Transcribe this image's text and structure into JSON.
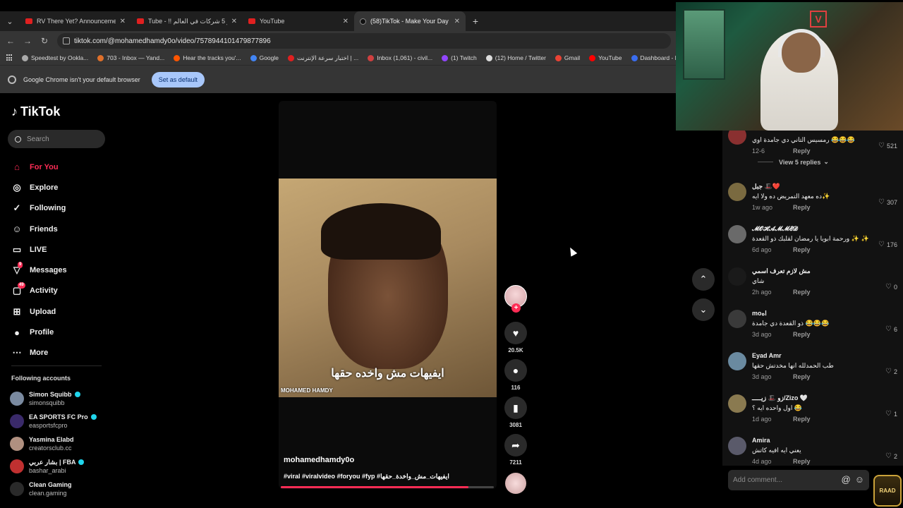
{
  "browser": {
    "tabs": [
      {
        "label": "RV There Yet? Announcement T",
        "favicon": "youtube",
        "active": false
      },
      {
        "label": "Tube - !! أكبر 5 شركات في العالم",
        "favicon": "youtube",
        "active": false
      },
      {
        "label": "YouTube",
        "favicon": "youtube",
        "active": false
      },
      {
        "label": "(58)TikTok - Make Your Day",
        "favicon": "tiktok",
        "active": true
      }
    ],
    "url": "tiktok.com/@mohamedhamdy0o/video/7578944101479877896",
    "bookmarks": [
      {
        "label": "Speedtest by Ookla...",
        "color": "#aaaaaa"
      },
      {
        "label": "703 - Inbox — Yand...",
        "color": "#e0702a"
      },
      {
        "label": "Hear the tracks you'...",
        "color": "#ff5500"
      },
      {
        "label": "Google",
        "color": "#4285f4"
      },
      {
        "label": "اختبار سرعة الإنترنت | ...",
        "color": "#e02020"
      },
      {
        "label": "Inbox (1,061) - civil...",
        "color": "#d04040"
      },
      {
        "label": "(1) Twitch",
        "color": "#9146ff"
      },
      {
        "label": "(12) Home / Twitter",
        "color": "#dddddd"
      },
      {
        "label": "Gmail",
        "color": "#ea4335"
      },
      {
        "label": "YouTube",
        "color": "#ff0000"
      },
      {
        "label": "Dashboard - Restre...",
        "color": "#3a6df0"
      }
    ],
    "infobar_text": "Google Chrome isn't your default browser",
    "set_default_label": "Set as default"
  },
  "tiktok": {
    "logo_text": "TikTok",
    "search_placeholder": "Search",
    "nav": [
      {
        "label": "For You",
        "icon": "home-icon",
        "glyph": "⌂",
        "active": true,
        "badge": ""
      },
      {
        "label": "Explore",
        "icon": "compass-icon",
        "glyph": "◎",
        "active": false,
        "badge": ""
      },
      {
        "label": "Following",
        "icon": "following-icon",
        "glyph": "✓",
        "active": false,
        "badge": ""
      },
      {
        "label": "Friends",
        "icon": "friends-icon",
        "glyph": "☺",
        "active": false,
        "badge": ""
      },
      {
        "label": "LIVE",
        "icon": "live-icon",
        "glyph": "▭",
        "active": false,
        "badge": ""
      },
      {
        "label": "Messages",
        "icon": "messages-icon",
        "glyph": "▽",
        "active": false,
        "badge": "9"
      },
      {
        "label": "Activity",
        "icon": "activity-icon",
        "glyph": "▢",
        "active": false,
        "badge": "49"
      },
      {
        "label": "Upload",
        "icon": "upload-icon",
        "glyph": "⊞",
        "active": false,
        "badge": ""
      },
      {
        "label": "Profile",
        "icon": "profile-avatar-icon",
        "glyph": "●",
        "active": false,
        "badge": ""
      },
      {
        "label": "More",
        "icon": "more-icon",
        "glyph": "⋯",
        "active": false,
        "badge": ""
      }
    ],
    "following_title": "Following accounts",
    "following": [
      {
        "name": "Simon Squibb",
        "handle": "simonsquibb",
        "verified": true,
        "color": "#7a8aa0"
      },
      {
        "name": "EA SPORTS FC Pro",
        "handle": "easportsfcpro",
        "verified": true,
        "color": "#3a2a6a"
      },
      {
        "name": "Yasmina Elabd",
        "handle": "creatorsclub.cc",
        "verified": false,
        "color": "#b09080"
      },
      {
        "name": "بشار عربي | FBA",
        "handle": "bashar_arabi",
        "verified": true,
        "color": "#c03030"
      },
      {
        "name": "Clean Gaming",
        "handle": "clean.gaming",
        "verified": false,
        "color": "#2a2a2a"
      }
    ],
    "video": {
      "subtitle": "ايفيهات مش واخده حقها",
      "watermark": "MOHAMED HAMDY",
      "author": "mohamedhamdy0o",
      "tags": "#viral #viralvideo #foryou #fyp #ايفيهات_مش_واخدة_حقها",
      "progress": 0.88
    },
    "actions": {
      "likes": "20.5K",
      "comments": "116",
      "saves": "3081",
      "shares": "7211"
    },
    "comments": [
      {
        "user": "",
        "text": "رمسيس التاني دي جامدة اوي 😂😂😂",
        "time": "12-6",
        "reply": "Reply",
        "likes": "521",
        "color": "#8a3030",
        "view_replies": "View 5 replies"
      },
      {
        "user": "جبل 🎩❤️",
        "text": "ده معهد التمريض ده ولا ايه✨",
        "time": "1w ago",
        "reply": "Reply",
        "likes": "307",
        "color": "#7a6a40",
        "view_replies": ""
      },
      {
        "user": "𝓜𝓞𝓗𝓐𝓜𝓜𝓔𝓓",
        "text": "ورحمة ابويا يا رمضان لقلبك ذو القعدة ✨ ✨",
        "time": "6d ago",
        "reply": "Reply",
        "likes": "176",
        "color": "#6a6a6a",
        "view_replies": ""
      },
      {
        "user": "مش لازم تعرف اسمي",
        "text": "شاي",
        "time": "2h ago",
        "reply": "Reply",
        "likes": "0",
        "color": "#1a1a1a",
        "view_replies": ""
      },
      {
        "user": "moاه",
        "text": "ذو القعدة دي جامدة 😂😂😂",
        "time": "3d ago",
        "reply": "Reply",
        "likes": "6",
        "color": "#3a3a3a",
        "view_replies": ""
      },
      {
        "user": "Eyad Amr",
        "text": "طب الحمدلله انها مخدتش حقها",
        "time": "3d ago",
        "reply": "Reply",
        "likes": "2",
        "color": "#6a8aa0",
        "view_replies": ""
      },
      {
        "user": "زو 🎩 زيـــــ/Zizo 🤍",
        "text": "اول واحده ايه ؟ 😂",
        "time": "1d ago",
        "reply": "Reply",
        "likes": "1",
        "color": "#8a7a50",
        "view_replies": ""
      },
      {
        "user": "Amira",
        "text": "يعني ايه افيه كاتش",
        "time": "4d ago",
        "reply": "Reply",
        "likes": "2",
        "color": "#5a5a6a",
        "view_replies": ""
      }
    ],
    "add_comment_placeholder": "Add comment...",
    "overlay_badge": "RAAD"
  },
  "colors": {
    "accent": "#fe2c55",
    "verified": "#20d5ec"
  }
}
